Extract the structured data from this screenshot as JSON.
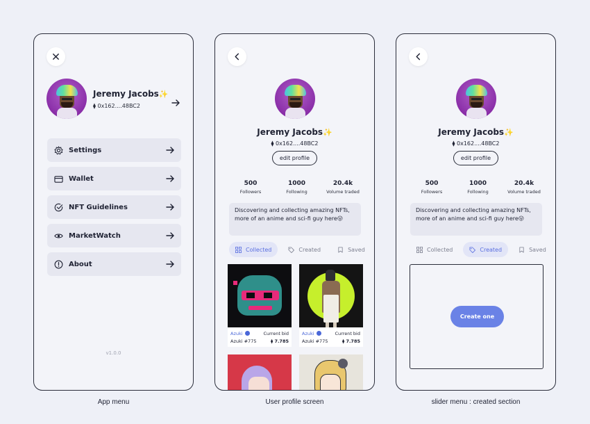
{
  "colors": {
    "accent": "#6a82e6",
    "tab_active_text": "#5a6fe0",
    "background": "#eef0f7"
  },
  "user": {
    "name": "Jeremy Jacobs",
    "sparkle": "✨",
    "address": "⧫ 0x162....48BC2"
  },
  "menu": {
    "close_icon": "close-icon",
    "items": [
      {
        "label": "Settings",
        "icon": "gear-icon"
      },
      {
        "label": "Wallet",
        "icon": "wallet-icon"
      },
      {
        "label": "NFT Guidelines",
        "icon": "check-circle-icon"
      },
      {
        "label": "MarketWatch",
        "icon": "eye-icon"
      },
      {
        "label": "About",
        "icon": "info-icon"
      }
    ],
    "version": "v1.0.0"
  },
  "profile": {
    "back_icon": "back-arrow-icon",
    "edit_label": "edit profile",
    "stats": [
      {
        "value": "500",
        "label": "Followers"
      },
      {
        "value": "1000",
        "label": "Following"
      },
      {
        "value": "20.4k",
        "label": "Volume traded"
      }
    ],
    "bio": "Discovering and collecting amazing NFTs, more of an anime and sci-fi guy here😛",
    "tabs": [
      {
        "label": "Collected",
        "icon": "grid-icon"
      },
      {
        "label": "Created",
        "icon": "tag-icon"
      },
      {
        "label": "Saved",
        "icon": "bookmark-icon"
      }
    ],
    "cards": [
      {
        "collection": "Azuki",
        "bid_label": "Current bid",
        "item": "Azuki #775",
        "price": "7.785"
      },
      {
        "collection": "Azuki",
        "bid_label": "Current bid",
        "item": "Azuki #775",
        "price": "7.785"
      }
    ]
  },
  "created": {
    "create_label": "Create one"
  },
  "captions": {
    "menu": "App menu",
    "profile": "User profile screen",
    "created": "slider menu : created section"
  }
}
